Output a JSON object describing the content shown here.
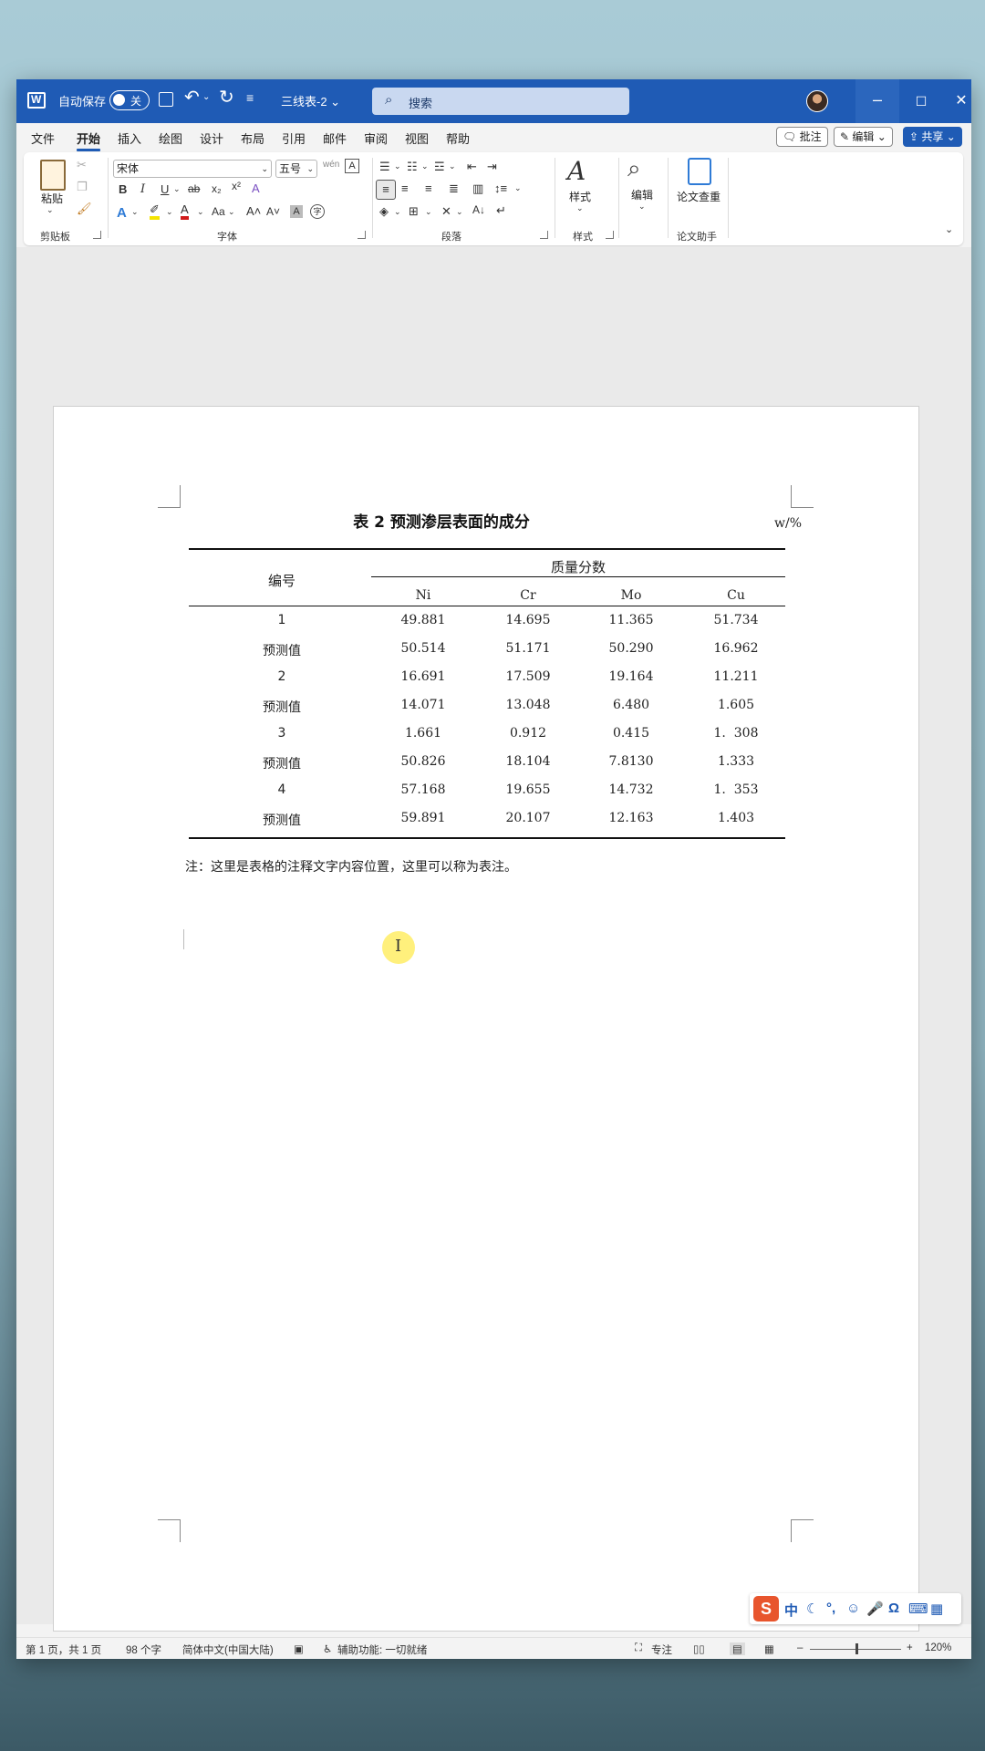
{
  "titlebar": {
    "autosave_label": "自动保存",
    "autosave_state": "关",
    "doc_title": "三线表-2 ⌄",
    "search_placeholder": "搜索"
  },
  "menu": {
    "items": [
      "文件",
      "开始",
      "插入",
      "绘图",
      "设计",
      "布局",
      "引用",
      "邮件",
      "审阅",
      "视图",
      "帮助"
    ],
    "active": "开始",
    "comment_btn": "批注",
    "edit_btn": "编辑 ⌄",
    "share_btn": "共享 ⌄"
  },
  "ribbon": {
    "paste_label": "粘贴",
    "clipboard_group": "剪贴板",
    "font_name": "宋体",
    "font_size": "五号",
    "font_group": "字体",
    "paragraph_group": "段落",
    "styles_label": "样式",
    "styles_group": "样式",
    "editing_label": "编辑",
    "paper_check_label": "论文查重",
    "paper_group": "论文助手"
  },
  "document": {
    "table_title": "表 2  预测渗层表面的成分",
    "unit": "w/%",
    "header_id": "编号",
    "header_group": "质量分数",
    "columns": [
      "Ni",
      "Cr",
      "Mo",
      "Cu"
    ],
    "rows": [
      {
        "id": "1",
        "values": [
          "49.881",
          "14.695",
          "11.365",
          "51.734"
        ]
      },
      {
        "id": "预测值",
        "values": [
          "50.514",
          "51.171",
          "50.290",
          "16.962"
        ]
      },
      {
        "id": "2",
        "values": [
          "16.691",
          "17.509",
          "19.164",
          "11.211"
        ]
      },
      {
        "id": "预测值",
        "values": [
          "14.071",
          "13.048",
          "6.480",
          "1.605"
        ]
      },
      {
        "id": "3",
        "values": [
          "1.661",
          "0.912",
          "0.415",
          "1.  308"
        ]
      },
      {
        "id": "预测值",
        "values": [
          "50.826",
          "18.104",
          "7.8130",
          "1.333"
        ]
      },
      {
        "id": "4",
        "values": [
          "57.168",
          "19.655",
          "14.732",
          "1.  353"
        ]
      },
      {
        "id": "预测值",
        "values": [
          "59.891",
          "20.107",
          "12.163",
          "1.403"
        ]
      }
    ],
    "note": "注：这里是表格的注释文字内容位置，这里可以称为表注。"
  },
  "ime": {
    "lang": "中"
  },
  "status": {
    "page": "第 1 页，共 1 页",
    "words": "98 个字",
    "language": "简体中文(中国大陆)",
    "accessibility": "辅助功能: 一切就绪",
    "focus": "专注",
    "zoom": "120%"
  },
  "colors": {
    "titlebar": "#1f5bb5",
    "accent": "#1f5bb5"
  }
}
